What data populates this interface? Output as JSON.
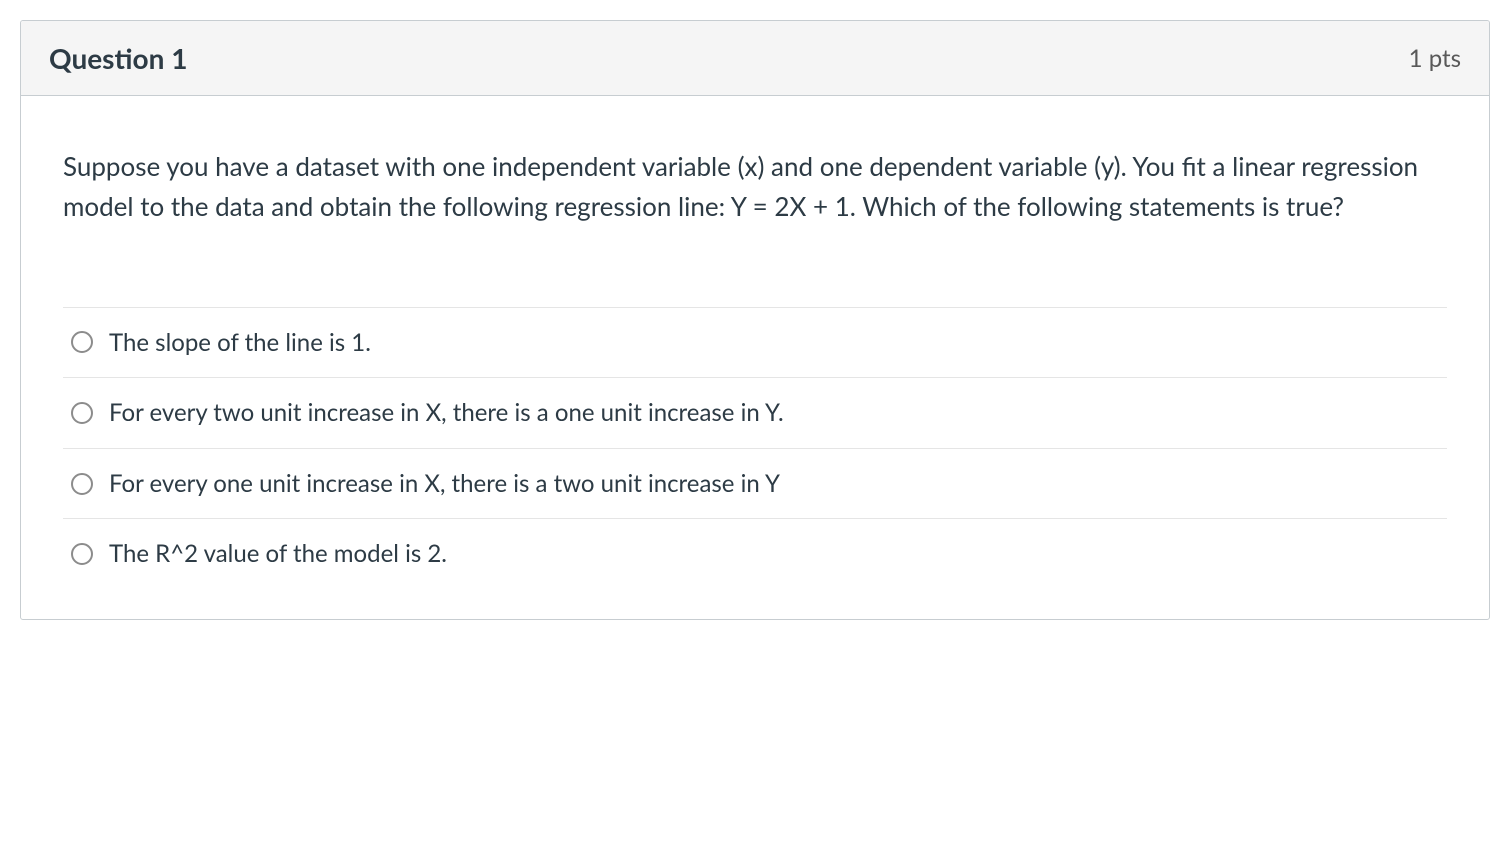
{
  "header": {
    "title": "Question 1",
    "points": "1 pts"
  },
  "question": {
    "text": "Suppose you have a dataset with one independent variable (x) and one dependent variable (y). You fit a linear regression model to the data and obtain the following regression line: Y = 2X + 1. Which of the following statements is true?"
  },
  "answers": [
    {
      "label": "The slope of the line is 1."
    },
    {
      "label": "For every two unit increase in X, there is a one unit increase in Y."
    },
    {
      "label": "For every one unit increase in X, there is a two unit increase in Y"
    },
    {
      "label": "The R^2 value of the model is 2."
    }
  ]
}
